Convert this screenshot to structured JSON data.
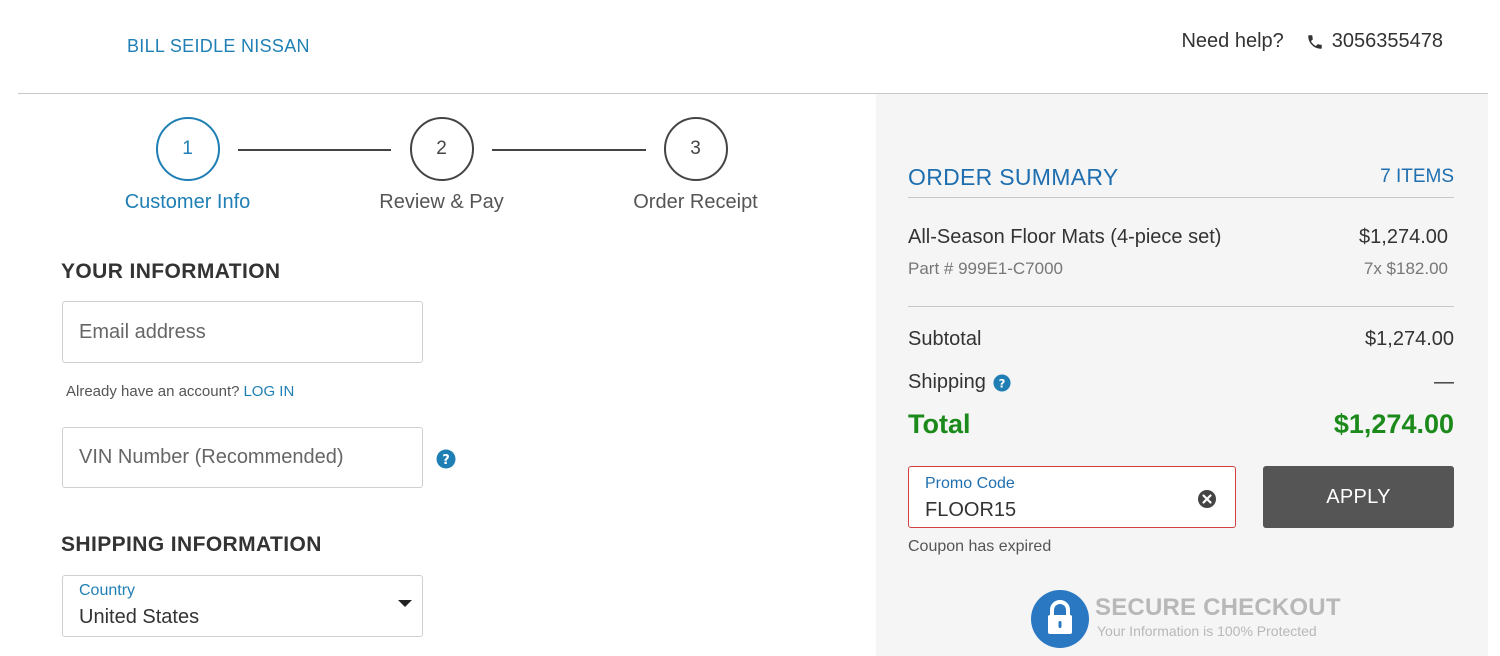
{
  "header": {
    "brand": "BILL SEIDLE NISSAN",
    "help_label": "Need help?",
    "phone": "3056355478"
  },
  "steps": [
    {
      "number": "1",
      "label": "Customer Info",
      "active": true
    },
    {
      "number": "2",
      "label": "Review & Pay",
      "active": false
    },
    {
      "number": "3",
      "label": "Order Receipt",
      "active": false
    }
  ],
  "your_info": {
    "title": "YOUR INFORMATION",
    "email_placeholder": "Email address",
    "account_prompt": "Already have an account?",
    "login_link": "LOG IN",
    "vin_placeholder": "VIN Number (Recommended)"
  },
  "shipping_info": {
    "title": "SHIPPING INFORMATION",
    "country_label": "Country",
    "country_value": "United States"
  },
  "summary": {
    "title": "ORDER SUMMARY",
    "item_count": "7 ITEMS",
    "item": {
      "name": "All-Season Floor Mats (4-piece set)",
      "price": "$1,274.00",
      "part": "Part # 999E1-C7000",
      "qty_price": "7x $182.00"
    },
    "subtotal_label": "Subtotal",
    "subtotal_value": "$1,274.00",
    "shipping_label": "Shipping",
    "shipping_value": "—",
    "total_label": "Total",
    "total_value": "$1,274.00",
    "promo_label": "Promo Code",
    "promo_value": "FLOOR15",
    "apply_label": "APPLY",
    "promo_error": "Coupon has expired",
    "secure_title": "SECURE CHECKOUT",
    "secure_sub": "Your Information is 100% Protected"
  },
  "colors": {
    "accent": "#1f7fb5",
    "total_green": "#1b8a1b",
    "error_border": "#d04040",
    "apply_bg": "#555555"
  }
}
